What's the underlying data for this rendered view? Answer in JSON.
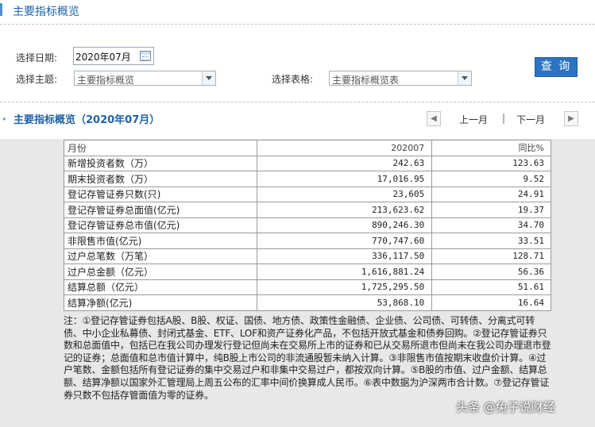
{
  "header": {
    "title": "主要指标概览"
  },
  "filters": {
    "date_label": "选择日期:",
    "date_value": "2020年07月",
    "theme_label": "选择主题:",
    "theme_value": "主要指标概览",
    "table_label": "选择表格:",
    "table_value": "主要指标概览表",
    "query_button": "查 询"
  },
  "section": {
    "title": "主要指标概览（2020年07月）",
    "prev_label": "上一月",
    "separator": "|",
    "next_label": "下一月",
    "prev_arrow": "◀",
    "next_arrow": "▶"
  },
  "table": {
    "columns": [
      "月份",
      "202007",
      "同比%"
    ],
    "rows": [
      [
        "新增投资者数（万）",
        "242.63",
        "123.63"
      ],
      [
        "期末投资者数（万）",
        "17,016.95",
        "9.52"
      ],
      [
        "登记存管证券只数(只)",
        "23,605",
        "24.91"
      ],
      [
        "登记存管证券总面值(亿元)",
        "213,623.62",
        "19.37"
      ],
      [
        "登记存管证券总市值(亿元)",
        "890,246.30",
        "34.70"
      ],
      [
        "非限售市值(亿元)",
        "770,747.60",
        "33.51"
      ],
      [
        "过户总笔数（万笔）",
        "336,117.50",
        "128.71"
      ],
      [
        "过户总金额（亿元）",
        "1,616,881.24",
        "56.36"
      ],
      [
        "结算总额（亿元）",
        "1,725,295.50",
        "51.61"
      ],
      [
        "结算净额(亿元)",
        "53,868.10",
        "16.64"
      ]
    ]
  },
  "note": "注：①登记存管证券包括A股、B股、权证、国债、地方债、政策性金融债、企业债、公司债、可转债、分离式可转债、中小企业私募债、封闭式基金、ETF、LOF和资产证券化产品，不包括开放式基金和债券回购。②登记存管证券只数和总面值中，包括已在我公司办理发行登记但尚未在交易所上市的证券和已从交易所退市但尚未在我公司办理退市登记的证券；总面值和总市值计算中，纯B股上市公司的非流通股暂未纳入计算。③非限售市值按期末收盘价计算。④过户笔数、金额包括所有登记证券的集中交易过户和非集中交易过户，都按双向计算。⑤B股的市值、过户金额、结算总额、结算净额以国家外汇管理局上周五公布的汇率中间价换算成人民币。⑥表中数据为沪深两市合计数。⑦登记存管证券只数不包括存管面值为零的证券。",
  "watermark": "头条 @兔子说财经",
  "colors": {
    "accent": "#1f63a8",
    "button": "#2b74c4",
    "panel_bg": "#e8e8e8"
  }
}
